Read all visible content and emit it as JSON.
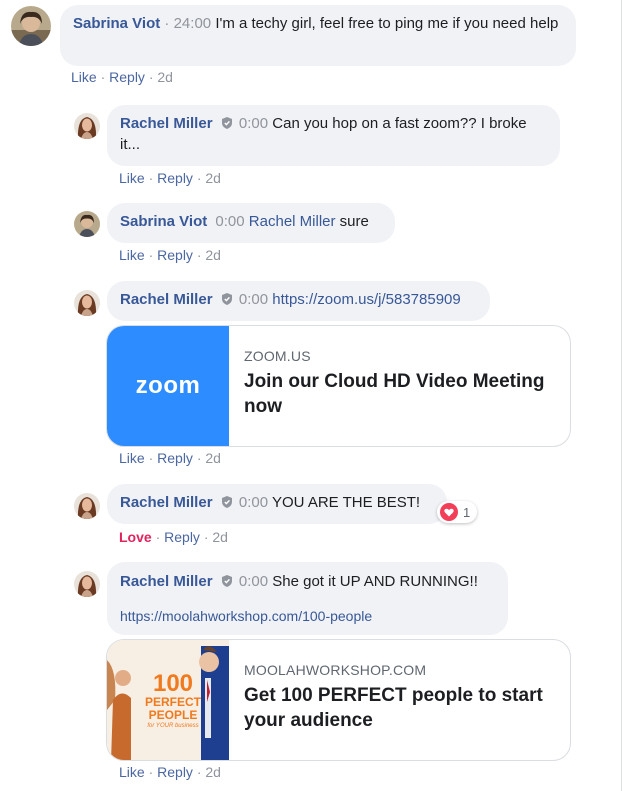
{
  "colors": {
    "author": "#385898",
    "bubble_bg": "#f0f2f5",
    "timestamp": "#90949c",
    "love": "#e0245e",
    "zoom_blue": "#2d8cff"
  },
  "comments": [
    {
      "author": "Sabrina Viot",
      "time": "24:00",
      "text": "I'm a techy girl, feel free to ping me if you need help",
      "actions": {
        "like": "Like",
        "reply": "Reply",
        "age": "2d"
      }
    },
    {
      "author": "Rachel Miller",
      "time": "0:00",
      "text": "Can you hop on a fast zoom?? I broke it...",
      "actions": {
        "like": "Like",
        "reply": "Reply",
        "age": "2d"
      }
    },
    {
      "author": "Sabrina Viot",
      "time": "0:00",
      "mention": "Rachel Miller",
      "text": "sure",
      "actions": {
        "like": "Like",
        "reply": "Reply",
        "age": "2d"
      }
    },
    {
      "author": "Rachel Miller",
      "time": "0:00",
      "link": "https://zoom.us/j/583785909",
      "preview": {
        "domain": "ZOOM.US",
        "title": "Join our Cloud HD Video Meeting now",
        "logo_text": "zoom"
      },
      "actions": {
        "like": "Like",
        "reply": "Reply",
        "age": "2d"
      }
    },
    {
      "author": "Rachel Miller",
      "time": "0:00",
      "text": "YOU ARE THE BEST!",
      "reaction": {
        "icon": "heart-icon",
        "count": "1"
      },
      "actions": {
        "like": "Love",
        "reply": "Reply",
        "age": "2d"
      }
    },
    {
      "author": "Rachel Miller",
      "time": "0:00",
      "text": "She got it UP AND RUNNING!!",
      "link": "https://moolahworkshop.com/100-people",
      "preview": {
        "domain": "MOOLAHWORKSHOP.COM",
        "title": "Get 100 PERFECT people to start your audience",
        "thumb_number": "100",
        "thumb_line1": "PERFECT",
        "thumb_line2": "PEOPLE",
        "thumb_line3": "for YOUR business"
      },
      "actions": {
        "like": "Like",
        "reply": "Reply",
        "age": "2d"
      }
    }
  ],
  "separator": "·"
}
